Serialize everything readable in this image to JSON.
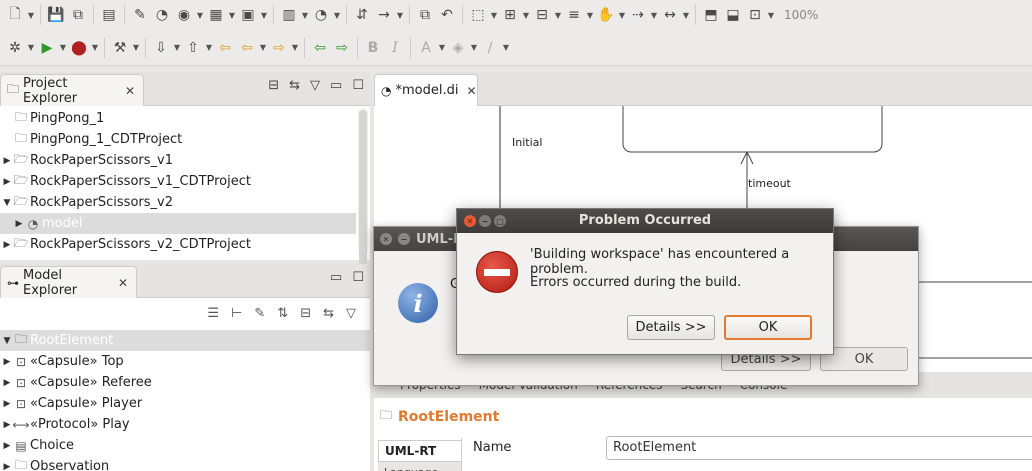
{
  "toolbar": {
    "zoom": "100%"
  },
  "project_explorer": {
    "title": "Project Explorer",
    "items": [
      {
        "label": "PingPong_1",
        "twisty": "",
        "indent": 0
      },
      {
        "label": "PingPong_1_CDTProject",
        "twisty": "",
        "indent": 0
      },
      {
        "label": "RockPaperScissors_v1",
        "twisty": "▶",
        "indent": 0
      },
      {
        "label": "RockPaperScissors_v1_CDTProject",
        "twisty": "▶",
        "indent": 0
      },
      {
        "label": "RockPaperScissors_v2",
        "twisty": "▼",
        "indent": 0
      },
      {
        "label": "model",
        "twisty": "▶",
        "indent": 1,
        "selected": true
      },
      {
        "label": "RockPaperScissors_v2_CDTProject",
        "twisty": "▶",
        "indent": 0
      }
    ]
  },
  "model_explorer": {
    "title": "Model Explorer",
    "items": [
      {
        "label": "RootElement",
        "twisty": "▼",
        "selected": true,
        "icon": "package"
      },
      {
        "label": "«Capsule» Top",
        "twisty": "▶",
        "icon": "capsule"
      },
      {
        "label": "«Capsule» Referee",
        "twisty": "▶",
        "icon": "capsule"
      },
      {
        "label": "«Capsule» Player",
        "twisty": "▶",
        "icon": "capsule"
      },
      {
        "label": "«Protocol» Play",
        "twisty": "▶",
        "icon": "protocol"
      },
      {
        "label": "Choice",
        "twisty": "▶",
        "icon": "enum"
      },
      {
        "label": "Observation",
        "twisty": "▶",
        "icon": "package"
      }
    ]
  },
  "editor": {
    "tab_label": "*model.di",
    "diagram": {
      "initial_label": "Initial",
      "transition_label": "timeout"
    }
  },
  "properties": {
    "tabs": [
      "Properties",
      "Model Validation",
      "References",
      "Search",
      "Console"
    ],
    "title": "RootElement",
    "side_tabs": [
      "UML-RT",
      "Language"
    ],
    "name_label": "Name",
    "name_value": "RootElement"
  },
  "background_dialog": {
    "title": "UML-R",
    "text": "G",
    "details_label": "Details >>",
    "ok_label": "OK"
  },
  "error_dialog": {
    "title": "Problem Occurred",
    "message": "'Building workspace' has encountered a problem.",
    "detail": "Errors occurred during the build.",
    "details_label": "Details >>",
    "ok_label": "OK"
  },
  "colors": {
    "accent": "#e07a2e",
    "title_bar": "#3c3b37",
    "error_red": "#c0251b"
  }
}
